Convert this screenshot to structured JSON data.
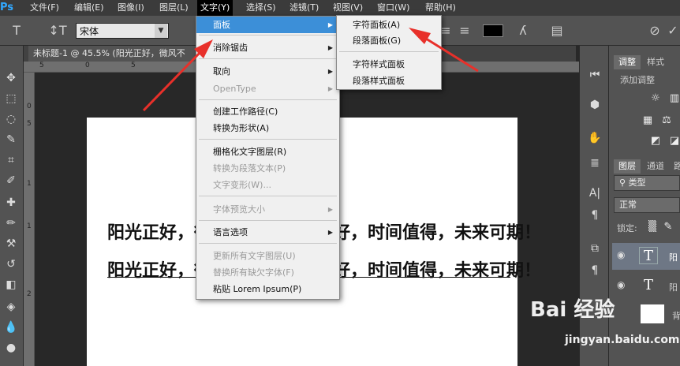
{
  "app": {
    "logo": "Ps"
  },
  "menubar": [
    {
      "label": "文件(F)"
    },
    {
      "label": "编辑(E)"
    },
    {
      "label": "图像(I)"
    },
    {
      "label": "图层(L)"
    },
    {
      "label": "文字(Y)"
    },
    {
      "label": "选择(S)"
    },
    {
      "label": "滤镜(T)"
    },
    {
      "label": "视图(V)"
    },
    {
      "label": "窗口(W)"
    },
    {
      "label": "帮助(H)"
    }
  ],
  "options_bar": {
    "font_family": "宋体",
    "text_color": "#000000"
  },
  "document": {
    "tab_title": "未标题-1 @ 45.5% (阳光正好，微风不"
  },
  "rulers": {
    "h_ticks": [
      "5",
      "0",
      "5"
    ],
    "v_ticks": [
      "0",
      "5",
      "1",
      "1",
      "2"
    ]
  },
  "canvas": {
    "line1": "阳光正好，微风不燥，岁月静好，时间值得，未来可期！",
    "line2": "阳光正好，微风不燥，岁月静好，时间值得，未来可期！"
  },
  "menu": {
    "items": [
      {
        "label": "面板",
        "highlighted": true,
        "submenu": true
      },
      {
        "label": "消除锯齿",
        "submenu": true
      },
      {
        "label": "取向",
        "submenu": true
      },
      {
        "label": "OpenType",
        "disabled": true,
        "submenu": true
      },
      {
        "label": "创建工作路径(C)"
      },
      {
        "label": "转换为形状(A)"
      },
      {
        "label": "栅格化文字图层(R)"
      },
      {
        "label": "转换为段落文本(P)",
        "disabled": true
      },
      {
        "label": "文字变形(W)...",
        "disabled": true
      },
      {
        "label": "字体预览大小",
        "disabled": true,
        "submenu": true
      },
      {
        "label": "语言选项",
        "submenu": true
      },
      {
        "label": "更新所有文字图层(U)",
        "disabled": true
      },
      {
        "label": "替换所有缺欠字体(F)",
        "disabled": true
      },
      {
        "label": "粘贴 Lorem Ipsum(P)"
      }
    ]
  },
  "submenu": {
    "items": [
      {
        "label": "字符面板(A)"
      },
      {
        "label": "段落面板(G)"
      },
      {
        "label": "字符样式面板"
      },
      {
        "label": "段落样式面板"
      }
    ]
  },
  "panels": {
    "adjust_tabs": [
      "调整",
      "样式"
    ],
    "add_adjustment": "添加调整",
    "layer_tabs": [
      "图层",
      "通道",
      "路"
    ],
    "filter_label": "类型",
    "blend_mode": "正常",
    "lock_label": "锁定:",
    "layers": [
      {
        "name": "阳",
        "selected": true
      },
      {
        "name": "阳",
        "selected": false
      },
      {
        "name": "背",
        "selected": false
      }
    ]
  },
  "watermark": {
    "logo": "Bai 经验",
    "url": "jingyan.baidu.com"
  },
  "colors": {
    "accent": "#3c8fd8",
    "arrow": "#e8302a"
  }
}
